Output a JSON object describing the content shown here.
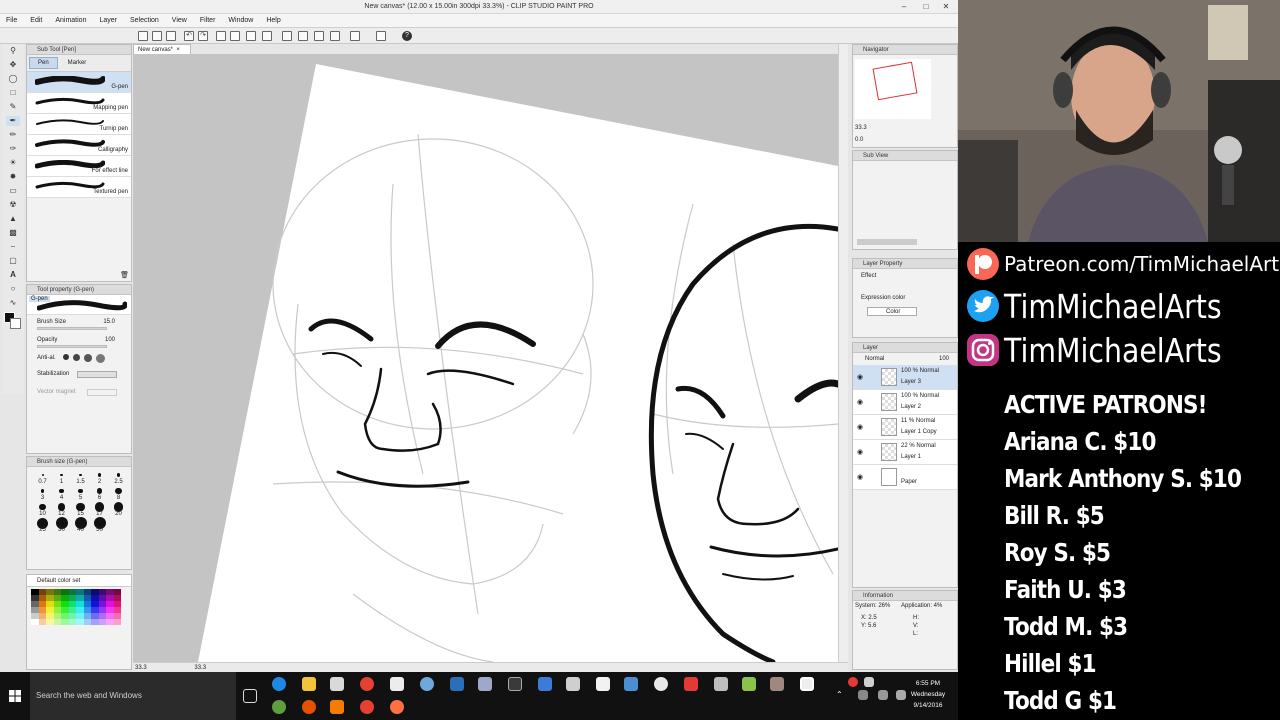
{
  "window": {
    "title": "New canvas* (12.00 x 15.00in 300dpi 33.3%) - CLIP STUDIO PAINT PRO",
    "menu": [
      "File",
      "Edit",
      "Animation",
      "Layer",
      "Selection",
      "View",
      "Filter",
      "Window",
      "Help"
    ]
  },
  "document": {
    "tab": "New canvas*",
    "zoom": "33.3",
    "rotation": "33.3"
  },
  "subtool": {
    "header": "Sub Tool [Pen]",
    "tabs": [
      "Pen",
      "Marker"
    ],
    "brushes": [
      "G-pen",
      "Mapping pen",
      "Turnip pen",
      "Calligraphy",
      "For effect line",
      "Textured pen"
    ]
  },
  "toolprop": {
    "header": "Tool property (G-pen)",
    "name": "G-pen",
    "brush_size_label": "Brush Size",
    "brush_size": "15.0",
    "opacity_label": "Opacity",
    "opacity": "100",
    "antialias_label": "Anti-al.",
    "stabilization_label": "Stabilization",
    "vector_label": "Vector magnet"
  },
  "brushsize": {
    "header": "Brush size (G-pen)",
    "sizes": [
      "0.7",
      "1",
      "1.5",
      "2",
      "2.5",
      "3",
      "4",
      "5",
      "6",
      "8",
      "10",
      "12",
      "15",
      "17",
      "20",
      "25",
      "30",
      "40",
      "50"
    ]
  },
  "colorset": {
    "name": "Default color set"
  },
  "navigator": {
    "header": "Navigator",
    "zoom": "33.3",
    "angle": "0.0"
  },
  "subview": {
    "header": "Sub View"
  },
  "layerprop": {
    "header": "Layer Property",
    "effect_label": "Effect",
    "expression_label": "Expression color",
    "expression_value": "Color"
  },
  "layers": {
    "header": "Layer",
    "mode": "Normal",
    "opacity": "100",
    "items": [
      {
        "blend": "100 %  Normal",
        "name": "Layer 3"
      },
      {
        "blend": "100 %  Normal",
        "name": "Layer 2"
      },
      {
        "blend": "11 %  Normal",
        "name": "Layer 1 Copy"
      },
      {
        "blend": "22 %  Normal",
        "name": "Layer 1"
      },
      {
        "blend": "",
        "name": "Paper"
      }
    ]
  },
  "info": {
    "header": "Information",
    "system": "System: 26%",
    "application": "Application:  4%",
    "x": "X: 2.5",
    "y": "Y: 5.6",
    "h": "H:",
    "v": "V:",
    "l": "L:"
  },
  "overlay": {
    "patreon": "Patreon.com/TimMichaelArts",
    "twitter": "TimMichaelArts",
    "instagram": "TimMichaelArts",
    "heading": "ACTIVE PATRONS!",
    "patrons": [
      "Ariana C. $10",
      "Mark Anthony S. $10",
      "Bill R. $5",
      "Roy S. $5",
      "Faith U. $3",
      "Todd M. $3",
      "Hillel $1",
      "Todd G $1"
    ],
    "colors": {
      "patreon": "#f96854",
      "twitter": "#1da1f2",
      "instagram": "#c13584"
    }
  },
  "taskbar": {
    "search_placeholder": "Search the web and Windows",
    "time": "6:55 PM",
    "day": "Wednesday",
    "date": "9/14/2016"
  }
}
